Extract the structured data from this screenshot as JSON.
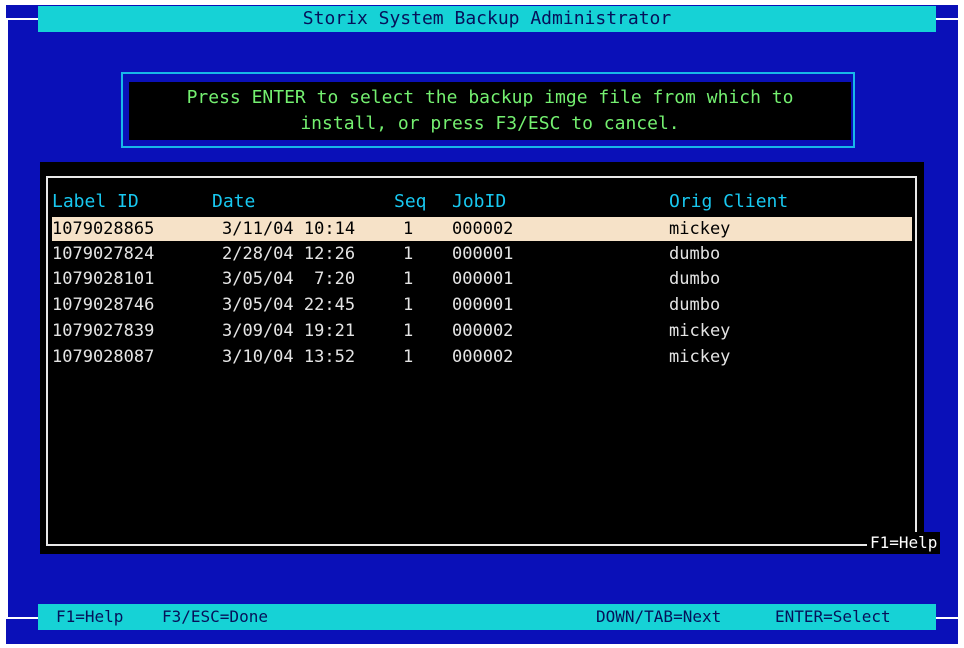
{
  "title": "Storix System Backup Administrator",
  "message": {
    "line1": "Press ENTER to select the backup imge file from which to",
    "line2": "install, or press F3/ESC to cancel."
  },
  "columns": [
    "Label ID",
    "Date",
    "Seq",
    "JobID",
    "Orig Client"
  ],
  "rows": [
    {
      "label_id": "1079028865",
      "date": "3/11/04 10:14",
      "seq": "1",
      "job_id": "000002",
      "orig_client": "mickey",
      "selected": true
    },
    {
      "label_id": "1079027824",
      "date": "2/28/04 12:26",
      "seq": "1",
      "job_id": "000001",
      "orig_client": "dumbo"
    },
    {
      "label_id": "1079028101",
      "date": "3/05/04  7:20",
      "seq": "1",
      "job_id": "000001",
      "orig_client": "dumbo"
    },
    {
      "label_id": "1079028746",
      "date": "3/05/04 22:45",
      "seq": "1",
      "job_id": "000001",
      "orig_client": "dumbo"
    },
    {
      "label_id": "1079027839",
      "date": "3/09/04 19:21",
      "seq": "1",
      "job_id": "000002",
      "orig_client": "mickey"
    },
    {
      "label_id": "1079028087",
      "date": "3/10/04 13:52",
      "seq": "1",
      "job_id": "000002",
      "orig_client": "mickey"
    }
  ],
  "list_help": "F1=Help",
  "status": {
    "help": "F1=Help",
    "done": "F3/ESC=Done",
    "next": "DOWN/TAB=Next",
    "select": "ENTER=Select"
  },
  "colors": {
    "background": "#0a10b8",
    "bar": "#16d2d6",
    "message_text": "#74f070",
    "header_text": "#18c8f0",
    "selection": "#f6e2c8"
  }
}
